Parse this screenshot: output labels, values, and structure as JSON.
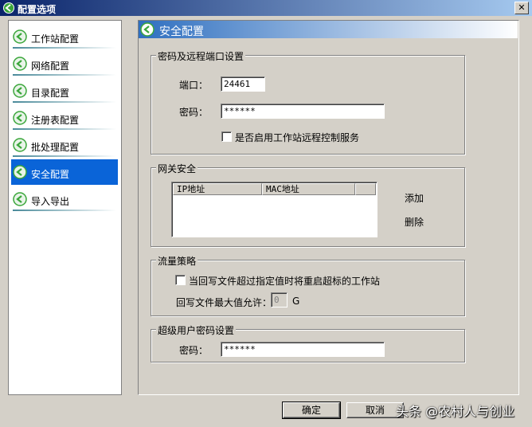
{
  "window": {
    "title": "配置选项",
    "close_glyph": "✕"
  },
  "sidebar": {
    "items": [
      {
        "label": "工作站配置",
        "icon": "green-circle-arrow-icon",
        "active": false
      },
      {
        "label": "网络配置",
        "icon": "green-circle-arrow-icon",
        "active": false
      },
      {
        "label": "目录配置",
        "icon": "green-circle-arrow-icon",
        "active": false
      },
      {
        "label": "注册表配置",
        "icon": "green-circle-arrow-icon",
        "active": false
      },
      {
        "label": "批处理配置",
        "icon": "green-circle-arrow-icon",
        "active": false
      },
      {
        "label": "安全配置",
        "icon": "green-circle-arrow-icon",
        "active": true
      },
      {
        "label": "导入导出",
        "icon": "green-circle-arrow-icon",
        "active": false
      }
    ]
  },
  "panel": {
    "title": "安全配置",
    "password_section": {
      "legend": "密码及远程端口设置",
      "port_label": "端口：",
      "port_value": "24461",
      "password_label": "密码：",
      "password_value": "******",
      "remote_checkbox_label": "是否启用工作站远程控制服务",
      "remote_checked": false
    },
    "gateway_section": {
      "legend": "网关安全",
      "columns": [
        "IP地址",
        "MAC地址",
        ""
      ],
      "rows": [],
      "add_label": "添加",
      "delete_label": "删除"
    },
    "traffic_section": {
      "legend": "流量策略",
      "restart_checkbox_label": "当回写文件超过指定值时将重启超标的工作站",
      "restart_checked": false,
      "max_label": "回写文件最大值允许：",
      "max_value": "0",
      "unit": "G"
    },
    "superuser_section": {
      "legend": "超级用户密码设置",
      "password_label": "密码：",
      "password_value": "******"
    }
  },
  "footer": {
    "ok_label": "确定",
    "cancel_label": "取消"
  },
  "watermark": "头条 @农村人与创业",
  "colors": {
    "title_bar": "#0a246a",
    "active_item": "#0a64d8",
    "panel_header": "#2e6fc0",
    "icon_green": "#3aa63a"
  }
}
